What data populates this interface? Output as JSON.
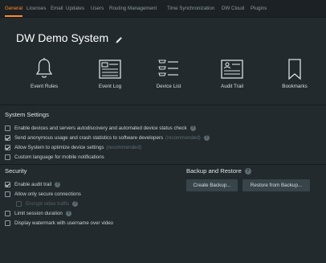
{
  "tabs": [
    {
      "label": "General",
      "active": true
    },
    {
      "label": "Licenses"
    },
    {
      "label": "Email"
    },
    {
      "label": "Updates"
    },
    {
      "label": "Users"
    },
    {
      "label": "Routing Management"
    },
    {
      "label": "Time Synchronization"
    },
    {
      "label": "DW Cloud"
    },
    {
      "label": "Plugins"
    }
  ],
  "system": {
    "name": "DW Demo System"
  },
  "tiles": [
    {
      "label": "Event Rules",
      "icon": "bell-icon"
    },
    {
      "label": "Event Log",
      "icon": "event-log-icon"
    },
    {
      "label": "Device List",
      "icon": "device-list-icon"
    },
    {
      "label": "Audit Trail",
      "icon": "audit-trail-icon"
    },
    {
      "label": "Bookmarks",
      "icon": "bookmark-icon"
    }
  ],
  "system_settings": {
    "title": "System Settings",
    "items": [
      {
        "label": "Enable devices and servers autodiscovery and automated device status check",
        "checked": false,
        "help": true
      },
      {
        "label": "Send anonymous usage and crash statistics to software developers",
        "suffix": "(recommended)",
        "checked": true,
        "help": true
      },
      {
        "label": "Allow System to optimize device settings",
        "suffix": "(recommended)",
        "checked": true
      },
      {
        "label": "Custom language for mobile notifications",
        "checked": false
      }
    ]
  },
  "security": {
    "title": "Security",
    "items": [
      {
        "label": "Enable audit trail",
        "checked": true,
        "help": true
      },
      {
        "label": "Allow only secure connections",
        "checked": false
      },
      {
        "label": "Encrypt video traffic",
        "checked": false,
        "disabled": true,
        "help": true
      },
      {
        "label": "Limit session duration",
        "checked": false,
        "help": true
      },
      {
        "label": "Display watermark with username over video",
        "checked": false
      }
    ]
  },
  "backup": {
    "title": "Backup and Restore",
    "create_label": "Create Backup...",
    "restore_label": "Restore from Backup..."
  },
  "colors": {
    "accent": "#ff8a2a",
    "background": "#222a2e",
    "tabbar": "#1b2124"
  }
}
